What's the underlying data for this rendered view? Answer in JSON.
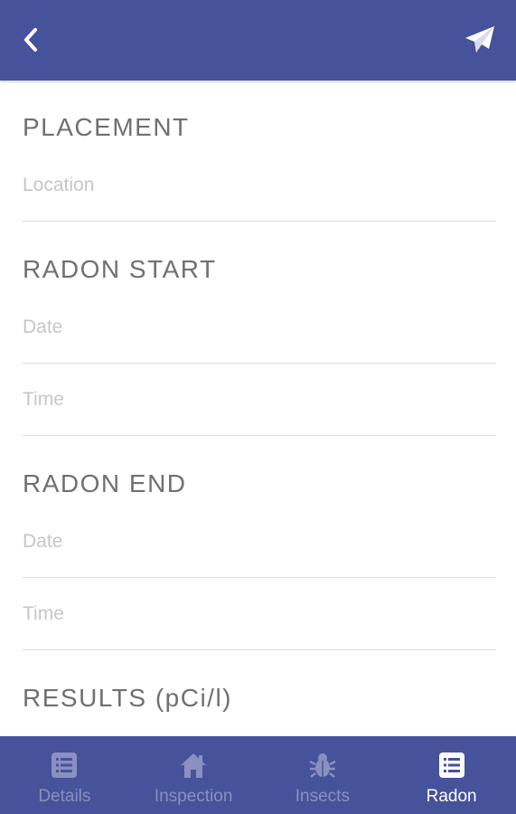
{
  "colors": {
    "header_bg": "#46529a",
    "tabbar_bg": "#46529a",
    "tab_inactive": "#8a90bf",
    "tab_active": "#ffffff"
  },
  "header": {
    "back_icon": "chevron-left-icon",
    "send_icon": "paper-plane-icon"
  },
  "placement": {
    "title": "PLACEMENT",
    "location_placeholder": "Location"
  },
  "radon_start": {
    "title": "RADON START",
    "date_placeholder": "Date",
    "time_placeholder": "Time"
  },
  "radon_end": {
    "title": "RADON END",
    "date_placeholder": "Date",
    "time_placeholder": "Time"
  },
  "results": {
    "title": "RESULTS (pCi/l)"
  },
  "tabs": [
    {
      "label": "Details",
      "icon": "list-icon",
      "active": false
    },
    {
      "label": "Inspection",
      "icon": "home-icon",
      "active": false
    },
    {
      "label": "Insects",
      "icon": "bug-icon",
      "active": false
    },
    {
      "label": "Radon",
      "icon": "list-icon",
      "active": true
    }
  ]
}
